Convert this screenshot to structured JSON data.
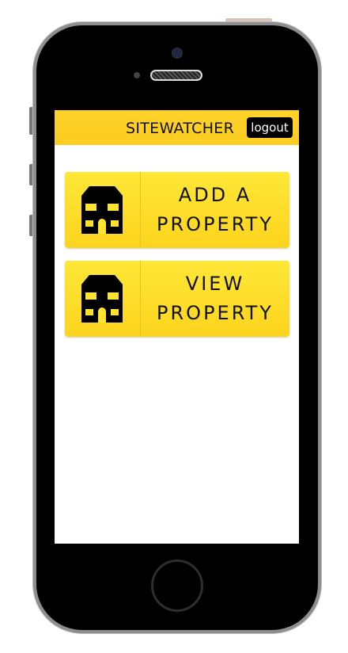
{
  "header": {
    "title": "SITEWATCHER",
    "logout_label": "logout"
  },
  "actions": [
    {
      "line1": "ADD A",
      "line2": "PROPERTY",
      "icon": "house-icon"
    },
    {
      "line1": "VIEW",
      "line2": "PROPERTY",
      "icon": "house-icon"
    }
  ],
  "colors": {
    "accent": "#fdd32a",
    "text": "#111111"
  }
}
